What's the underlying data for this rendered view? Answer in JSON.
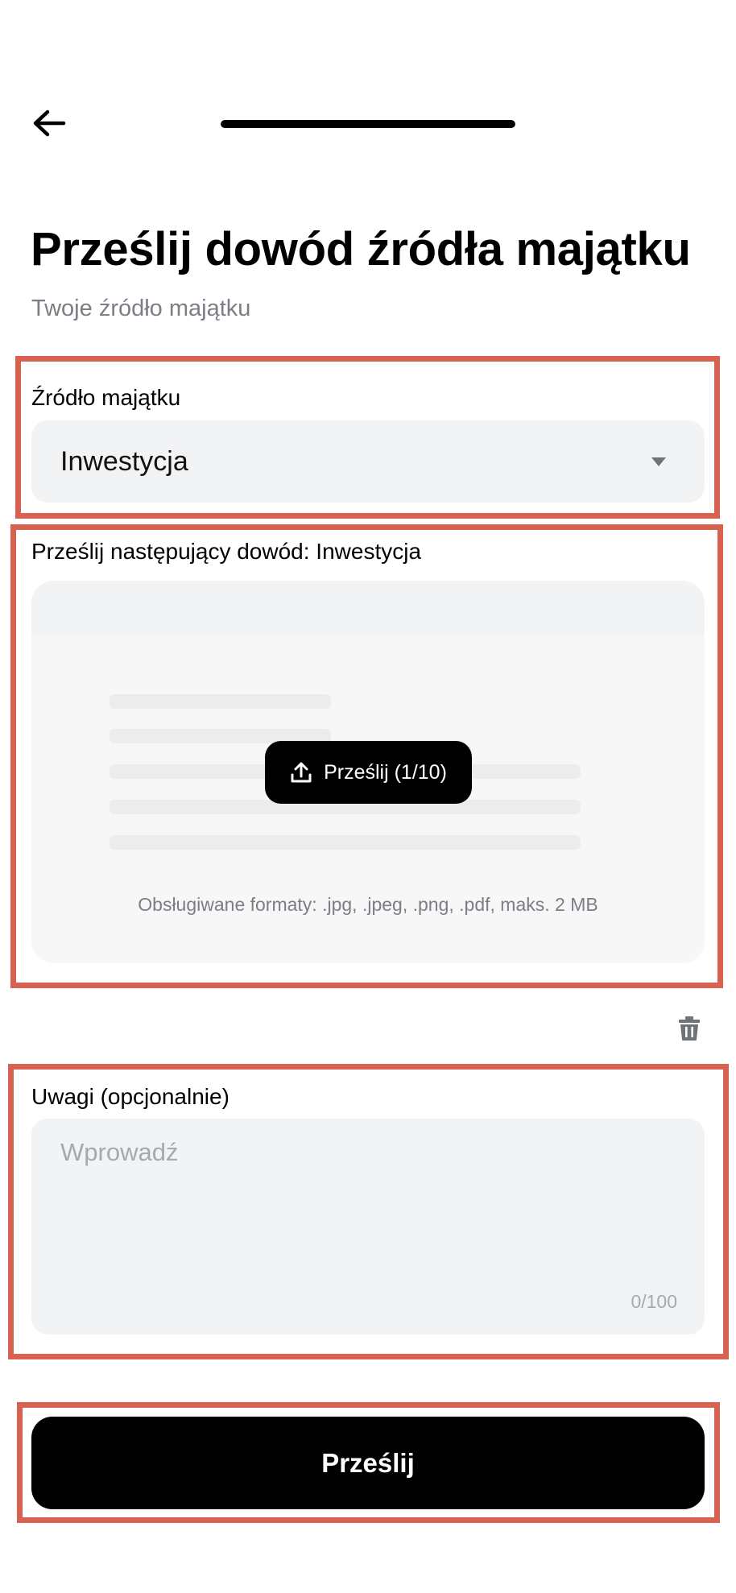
{
  "header": {
    "back_icon": "arrow-left-icon",
    "progress": 1.0
  },
  "title": "Prześlij dowód źródła majątku",
  "subtitle": "Twoje źródło majątku",
  "wealth_source": {
    "label": "Źródło majątku",
    "selected": "Inwestycja",
    "caret_icon": "caret-down-icon"
  },
  "evidence": {
    "label": "Prześlij następujący dowód: Inwestycja",
    "upload_button_label": "Prześlij (1/10)",
    "upload_icon": "upload-icon",
    "formats_hint": "Obsługiwane formaty: .jpg, .jpeg, .png, .pdf, maks. 2 MB",
    "delete_icon": "trash-icon"
  },
  "notes": {
    "label": "Uwagi (opcjonalnie)",
    "placeholder": "Wprowadź",
    "counter": "0/100"
  },
  "submit_label": "Prześlij",
  "colors": {
    "highlight": "#d9614f",
    "primary": "#000000",
    "field_bg": "#f1f3f4"
  }
}
